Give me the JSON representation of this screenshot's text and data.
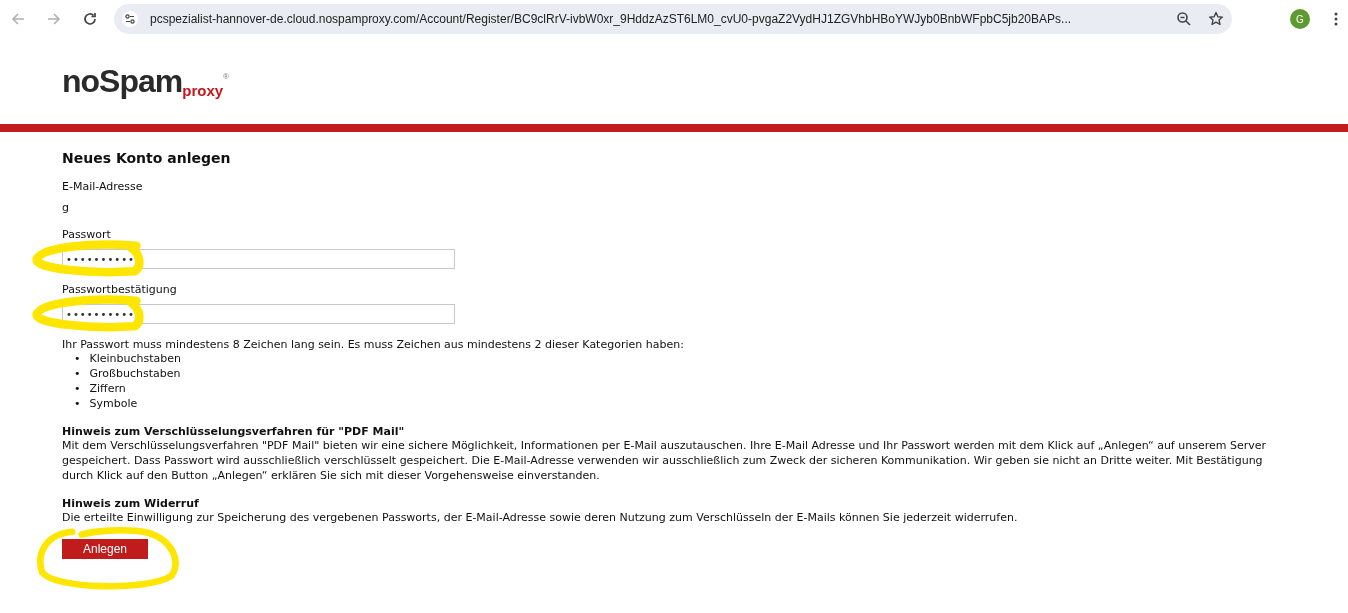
{
  "browser": {
    "url": "pcspezialist-hannover-de.cloud.nospamproxy.com/Account/Register/BC9clRrV-ivbW0xr_9HddzAzST6LM0_cvU0-pvgaZ2VydHJ1ZGVhbHBoYWJyb0BnbWFpbC5jb20BAPs...",
    "back_disabled": true,
    "forward_disabled": true,
    "avatar": "G"
  },
  "logo": {
    "main": "noSpam",
    "sub": "proxy",
    "mark": "®"
  },
  "form": {
    "title": "Neues Konto anlegen",
    "email": {
      "label": "E-Mail-Adresse",
      "value": "g"
    },
    "fields": [
      {
        "label": "Passwort",
        "value": "••••••••••",
        "highlighted": true
      },
      {
        "label": "Passwortbestätigung",
        "value": "••••••••••",
        "highlighted": true
      }
    ],
    "rules": {
      "intro": "Ihr Passwort muss mindestens 8 Zeichen lang sein. Es muss Zeichen aus mindestens 2 dieser Kategorien haben:",
      "items": [
        {
          "marker": "•",
          "text": "Kleinbuchstaben"
        },
        {
          "marker": "•",
          "text": "Großbuchstaben"
        },
        {
          "marker": "•",
          "text": "Ziffern"
        },
        {
          "marker": "•",
          "text": "Symbole"
        }
      ]
    },
    "notices": [
      {
        "heading": "Hinweis zum Verschlüsselungsverfahren für \"PDF Mail\"",
        "text": "Mit dem Verschlüsselungsverfahren \"PDF Mail\" bieten wir eine sichere Möglichkeit, Informationen per E-Mail auszutauschen. Ihre E-Mail Adresse und Ihr Passwort werden mit dem Klick auf „Anlegen“ auf unserem Server gespeichert. Dass Passwort wird ausschließlich verschlüsselt gespeichert. Die E-Mail-Adresse verwenden wir ausschließlich zum Zweck der sicheren Kommunikation. Wir geben sie nicht an Dritte weiter. Mit Bestätigung durch Klick auf den Button „Anlegen“ erklären Sie sich mit dieser Vorgehensweise einverstanden."
      },
      {
        "heading": "Hinweis zum Widerruf",
        "text": "Die erteilte Einwilligung zur Speicherung des vergebenen Passworts, der E-Mail-Adresse sowie deren Nutzung zum Verschlüsseln der E-Mails können Sie jederzeit widerrufen."
      }
    ],
    "submit": {
      "label": "Anlegen",
      "highlighted": true
    }
  }
}
